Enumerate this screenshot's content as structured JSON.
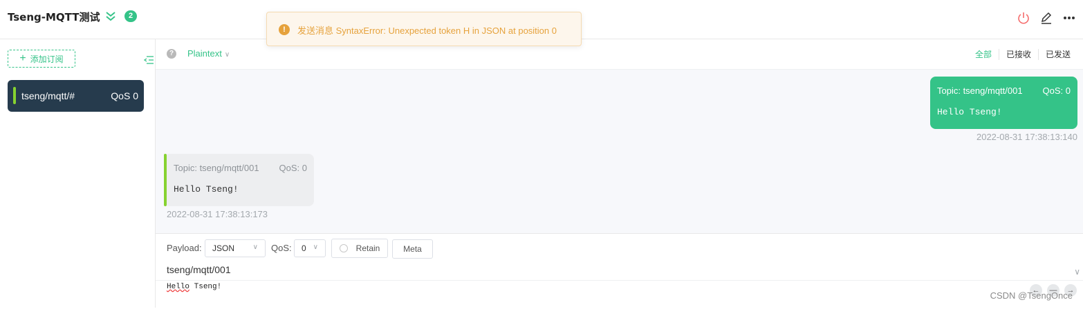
{
  "header": {
    "connection_name": "Tseng-MQTT测试",
    "connection_count": "2",
    "icons": [
      "expand-chevrons-icon",
      "power-icon",
      "edit-icon",
      "more-icon"
    ]
  },
  "toast": {
    "icon": "!",
    "message": "发送消息 SyntaxError: Unexpected token H in JSON at position 0"
  },
  "sidebar": {
    "add_subscription_label": "添加订阅",
    "add_icon": "+",
    "subscriptions": [
      {
        "topic": "tseng/mqtt/#",
        "qos": "QoS 0",
        "color": "#86d230"
      }
    ]
  },
  "filter": {
    "help_icon": "?",
    "format": "Plaintext",
    "tabs": [
      "全部",
      "已接收",
      "已发送"
    ]
  },
  "messages": {
    "sent": {
      "topic": "Topic: tseng/mqtt/001",
      "qos": "QoS: 0",
      "payload": "Hello Tseng!",
      "time": "2022-08-31 17:38:13:140"
    },
    "received": {
      "topic": "Topic: tseng/mqtt/001",
      "qos": "QoS: 0",
      "payload": "Hello Tseng!",
      "time": "2022-08-31 17:38:13:173"
    }
  },
  "composer": {
    "payload_label": "Payload:",
    "payload_type": "JSON",
    "qos_label": "QoS:",
    "qos_value": "0",
    "retain_label": "Retain",
    "meta_label": "Meta",
    "topic": "tseng/mqtt/001",
    "payload_word1": "Hello",
    "payload_word2": " Tseng!"
  },
  "watermark": "CSDN @TsengOnce",
  "colors": {
    "accent": "#34c388",
    "sidebar_active": "#263b4d",
    "warning": "#e6a23c",
    "bar": "#86d230"
  }
}
